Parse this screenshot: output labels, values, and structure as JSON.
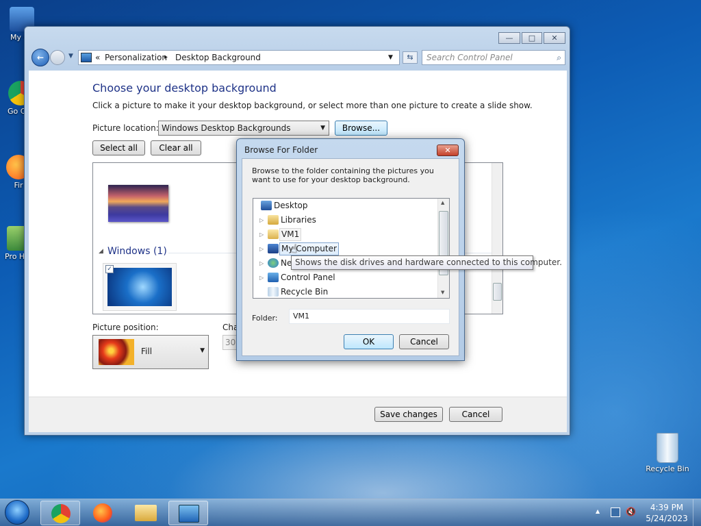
{
  "desktop": {
    "icons": [
      {
        "label": "My Co",
        "color": "#3a7bd5"
      },
      {
        "label": "Go Chr",
        "color": "#e34133"
      },
      {
        "label": "Fir",
        "color": "#ff7a1a"
      },
      {
        "label": "Pro Hac",
        "color": "#4aa34a"
      },
      {
        "label": "Recycle Bin",
        "color": "#cfe3f5"
      }
    ]
  },
  "window": {
    "title_buttons": {
      "minimize": "—",
      "maximize": "□",
      "close": "✕"
    },
    "address": {
      "chevrons": "«",
      "crumb1": "Personalization",
      "sep": "▸",
      "crumb2": "Desktop Background"
    },
    "search_placeholder": "Search Control Panel",
    "heading": "Choose your desktop background",
    "description": "Click a picture to make it your desktop background, or select more than one picture to create a slide show.",
    "location_label": "Picture location:",
    "location_value": "Windows Desktop Backgrounds",
    "browse_label": "Browse...",
    "select_all": "Select all",
    "clear_all": "Clear all",
    "group_label": "Windows (1)",
    "position_label": "Picture position:",
    "position_value": "Fill",
    "change_label": "Cha",
    "change_value": "30",
    "save_label": "Save changes",
    "cancel_label": "Cancel"
  },
  "dialog": {
    "title": "Browse For Folder",
    "close": "✕",
    "instruction": "Browse to the folder containing the pictures you want to use for your desktop background.",
    "tree": [
      {
        "label": "Desktop",
        "icon": "desktop-icon"
      },
      {
        "label": "Libraries",
        "icon": "libraries-icon"
      },
      {
        "label": "VM1",
        "icon": "user-folder-icon"
      },
      {
        "label": "My Computer",
        "icon": "computer-icon"
      },
      {
        "label": "Ne",
        "icon": "network-icon"
      },
      {
        "label": "Control Panel",
        "icon": "control-panel-icon"
      },
      {
        "label": "Recycle Bin",
        "icon": "recycle-bin-icon"
      }
    ],
    "tooltip": "Shows the disk drives and hardware connected to this computer.",
    "folder_label": "Folder:",
    "folder_value": "VM1",
    "ok": "OK",
    "cancel": "Cancel"
  },
  "taskbar": {
    "time": "4:39 PM",
    "date": "5/24/2023"
  }
}
